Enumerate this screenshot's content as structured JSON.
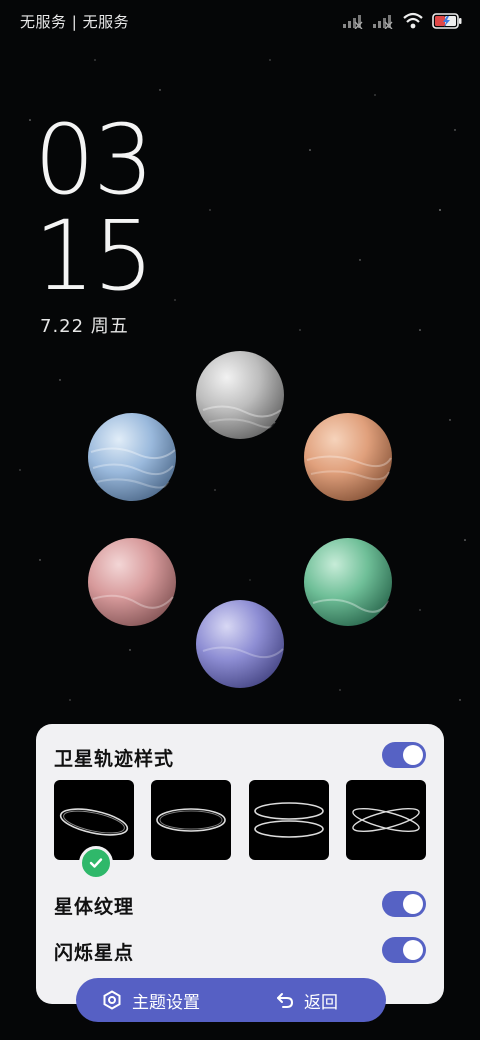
{
  "status_bar": {
    "carrier": "无服务 | 无服务",
    "icons": [
      "signal-1-icon",
      "signal-2-icon",
      "wifi-icon",
      "battery-charging-icon"
    ]
  },
  "lockscreen": {
    "hour": "03",
    "minute": "15",
    "date": "7.22  周五"
  },
  "planets": [
    {
      "name": "gray",
      "color": "#bdbdbd"
    },
    {
      "name": "orange",
      "color": "#e0a07c"
    },
    {
      "name": "green",
      "color": "#6fbf98"
    },
    {
      "name": "purple",
      "color": "#8e8ed4"
    },
    {
      "name": "pink",
      "color": "#d79a9b"
    },
    {
      "name": "blue",
      "color": "#9ab9dc"
    }
  ],
  "settings": {
    "orbit_style": {
      "label": "卫星轨迹样式",
      "enabled": true,
      "selected_index": 0
    },
    "texture": {
      "label": "星体纹理",
      "enabled": true
    },
    "twinkle": {
      "label": "闪烁星点",
      "enabled": true
    }
  },
  "actions": {
    "theme_label": "主题设置",
    "back_label": "返回"
  },
  "colors": {
    "accent": "#5660c4",
    "check": "#2fb86a",
    "panel": "#f1f1f3"
  }
}
